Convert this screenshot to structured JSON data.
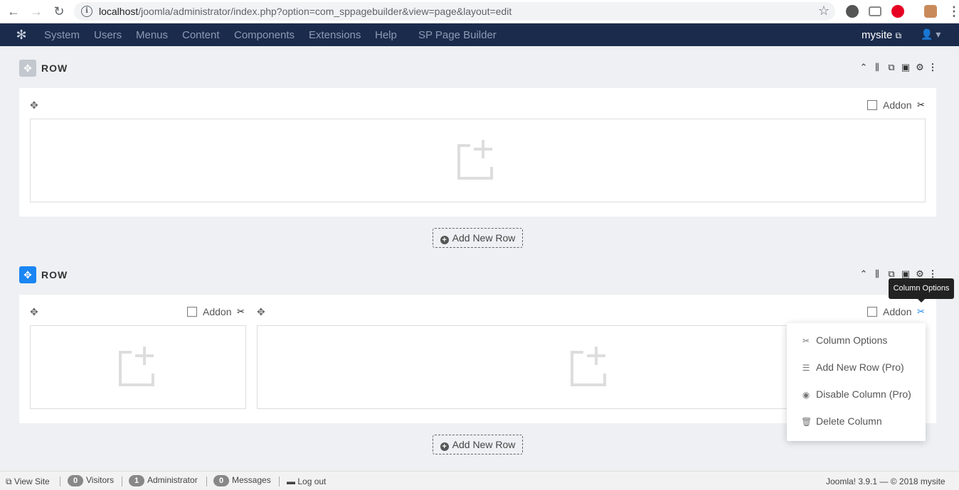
{
  "browser": {
    "url_host": "localhost",
    "url_path": "/joomla/administrator/index.php?option=com_sppagebuilder&view=page&layout=edit"
  },
  "admin_nav": {
    "items": [
      "System",
      "Users",
      "Menus",
      "Content",
      "Components",
      "Extensions",
      "Help",
      "SP Page Builder"
    ],
    "site_link": "mysite"
  },
  "rows": [
    {
      "label": "ROW"
    },
    {
      "label": "ROW"
    }
  ],
  "addon_label": "Addon",
  "add_new_row_label": "Add New Row",
  "tooltip": "Column Options",
  "dropdown": {
    "items": [
      "Column Options",
      "Add New Row (Pro)",
      "Disable Column (Pro)",
      "Delete Column"
    ]
  },
  "status_bar": {
    "view_site": "View Site",
    "visitors_count": "0",
    "visitors_label": "Visitors",
    "admin_count": "1",
    "admin_label": "Administrator",
    "messages_count": "0",
    "messages_label": "Messages",
    "logout": "Log out",
    "version": "Joomla! 3.9.1",
    "copyright": "© 2018 mysite"
  },
  "colors": {
    "nav_bg": "#1a2b4c",
    "active_row_handle": "#1a85f3",
    "inactive_row_handle": "#c3c8cf",
    "column_options_active": "#1a85f3"
  }
}
